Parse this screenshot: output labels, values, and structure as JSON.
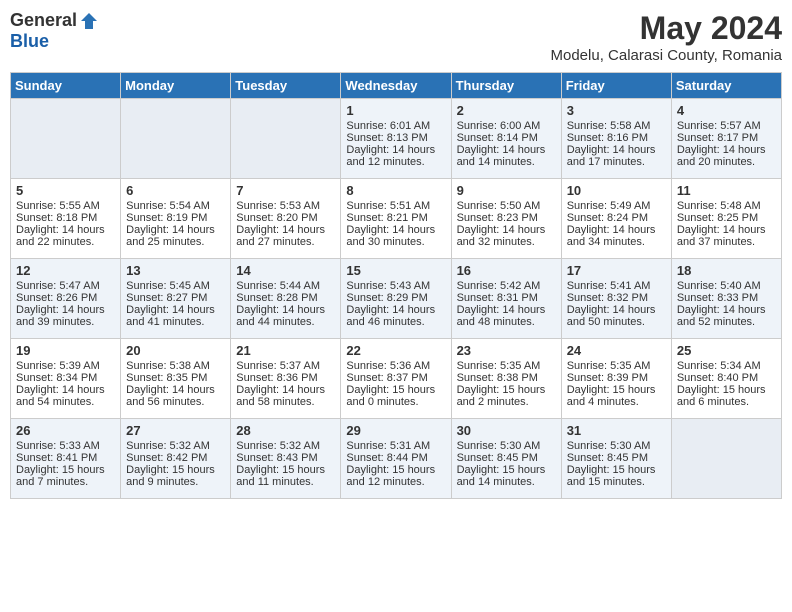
{
  "header": {
    "logo_general": "General",
    "logo_blue": "Blue",
    "month_title": "May 2024",
    "location": "Modelu, Calarasi County, Romania"
  },
  "days_of_week": [
    "Sunday",
    "Monday",
    "Tuesday",
    "Wednesday",
    "Thursday",
    "Friday",
    "Saturday"
  ],
  "weeks": [
    [
      {
        "day": "",
        "sunrise": "",
        "sunset": "",
        "daylight": ""
      },
      {
        "day": "",
        "sunrise": "",
        "sunset": "",
        "daylight": ""
      },
      {
        "day": "",
        "sunrise": "",
        "sunset": "",
        "daylight": ""
      },
      {
        "day": "1",
        "sunrise": "Sunrise: 6:01 AM",
        "sunset": "Sunset: 8:13 PM",
        "daylight": "Daylight: 14 hours and 12 minutes."
      },
      {
        "day": "2",
        "sunrise": "Sunrise: 6:00 AM",
        "sunset": "Sunset: 8:14 PM",
        "daylight": "Daylight: 14 hours and 14 minutes."
      },
      {
        "day": "3",
        "sunrise": "Sunrise: 5:58 AM",
        "sunset": "Sunset: 8:16 PM",
        "daylight": "Daylight: 14 hours and 17 minutes."
      },
      {
        "day": "4",
        "sunrise": "Sunrise: 5:57 AM",
        "sunset": "Sunset: 8:17 PM",
        "daylight": "Daylight: 14 hours and 20 minutes."
      }
    ],
    [
      {
        "day": "5",
        "sunrise": "Sunrise: 5:55 AM",
        "sunset": "Sunset: 8:18 PM",
        "daylight": "Daylight: 14 hours and 22 minutes."
      },
      {
        "day": "6",
        "sunrise": "Sunrise: 5:54 AM",
        "sunset": "Sunset: 8:19 PM",
        "daylight": "Daylight: 14 hours and 25 minutes."
      },
      {
        "day": "7",
        "sunrise": "Sunrise: 5:53 AM",
        "sunset": "Sunset: 8:20 PM",
        "daylight": "Daylight: 14 hours and 27 minutes."
      },
      {
        "day": "8",
        "sunrise": "Sunrise: 5:51 AM",
        "sunset": "Sunset: 8:21 PM",
        "daylight": "Daylight: 14 hours and 30 minutes."
      },
      {
        "day": "9",
        "sunrise": "Sunrise: 5:50 AM",
        "sunset": "Sunset: 8:23 PM",
        "daylight": "Daylight: 14 hours and 32 minutes."
      },
      {
        "day": "10",
        "sunrise": "Sunrise: 5:49 AM",
        "sunset": "Sunset: 8:24 PM",
        "daylight": "Daylight: 14 hours and 34 minutes."
      },
      {
        "day": "11",
        "sunrise": "Sunrise: 5:48 AM",
        "sunset": "Sunset: 8:25 PM",
        "daylight": "Daylight: 14 hours and 37 minutes."
      }
    ],
    [
      {
        "day": "12",
        "sunrise": "Sunrise: 5:47 AM",
        "sunset": "Sunset: 8:26 PM",
        "daylight": "Daylight: 14 hours and 39 minutes."
      },
      {
        "day": "13",
        "sunrise": "Sunrise: 5:45 AM",
        "sunset": "Sunset: 8:27 PM",
        "daylight": "Daylight: 14 hours and 41 minutes."
      },
      {
        "day": "14",
        "sunrise": "Sunrise: 5:44 AM",
        "sunset": "Sunset: 8:28 PM",
        "daylight": "Daylight: 14 hours and 44 minutes."
      },
      {
        "day": "15",
        "sunrise": "Sunrise: 5:43 AM",
        "sunset": "Sunset: 8:29 PM",
        "daylight": "Daylight: 14 hours and 46 minutes."
      },
      {
        "day": "16",
        "sunrise": "Sunrise: 5:42 AM",
        "sunset": "Sunset: 8:31 PM",
        "daylight": "Daylight: 14 hours and 48 minutes."
      },
      {
        "day": "17",
        "sunrise": "Sunrise: 5:41 AM",
        "sunset": "Sunset: 8:32 PM",
        "daylight": "Daylight: 14 hours and 50 minutes."
      },
      {
        "day": "18",
        "sunrise": "Sunrise: 5:40 AM",
        "sunset": "Sunset: 8:33 PM",
        "daylight": "Daylight: 14 hours and 52 minutes."
      }
    ],
    [
      {
        "day": "19",
        "sunrise": "Sunrise: 5:39 AM",
        "sunset": "Sunset: 8:34 PM",
        "daylight": "Daylight: 14 hours and 54 minutes."
      },
      {
        "day": "20",
        "sunrise": "Sunrise: 5:38 AM",
        "sunset": "Sunset: 8:35 PM",
        "daylight": "Daylight: 14 hours and 56 minutes."
      },
      {
        "day": "21",
        "sunrise": "Sunrise: 5:37 AM",
        "sunset": "Sunset: 8:36 PM",
        "daylight": "Daylight: 14 hours and 58 minutes."
      },
      {
        "day": "22",
        "sunrise": "Sunrise: 5:36 AM",
        "sunset": "Sunset: 8:37 PM",
        "daylight": "Daylight: 15 hours and 0 minutes."
      },
      {
        "day": "23",
        "sunrise": "Sunrise: 5:35 AM",
        "sunset": "Sunset: 8:38 PM",
        "daylight": "Daylight: 15 hours and 2 minutes."
      },
      {
        "day": "24",
        "sunrise": "Sunrise: 5:35 AM",
        "sunset": "Sunset: 8:39 PM",
        "daylight": "Daylight: 15 hours and 4 minutes."
      },
      {
        "day": "25",
        "sunrise": "Sunrise: 5:34 AM",
        "sunset": "Sunset: 8:40 PM",
        "daylight": "Daylight: 15 hours and 6 minutes."
      }
    ],
    [
      {
        "day": "26",
        "sunrise": "Sunrise: 5:33 AM",
        "sunset": "Sunset: 8:41 PM",
        "daylight": "Daylight: 15 hours and 7 minutes."
      },
      {
        "day": "27",
        "sunrise": "Sunrise: 5:32 AM",
        "sunset": "Sunset: 8:42 PM",
        "daylight": "Daylight: 15 hours and 9 minutes."
      },
      {
        "day": "28",
        "sunrise": "Sunrise: 5:32 AM",
        "sunset": "Sunset: 8:43 PM",
        "daylight": "Daylight: 15 hours and 11 minutes."
      },
      {
        "day": "29",
        "sunrise": "Sunrise: 5:31 AM",
        "sunset": "Sunset: 8:44 PM",
        "daylight": "Daylight: 15 hours and 12 minutes."
      },
      {
        "day": "30",
        "sunrise": "Sunrise: 5:30 AM",
        "sunset": "Sunset: 8:45 PM",
        "daylight": "Daylight: 15 hours and 14 minutes."
      },
      {
        "day": "31",
        "sunrise": "Sunrise: 5:30 AM",
        "sunset": "Sunset: 8:45 PM",
        "daylight": "Daylight: 15 hours and 15 minutes."
      },
      {
        "day": "",
        "sunrise": "",
        "sunset": "",
        "daylight": ""
      }
    ]
  ]
}
